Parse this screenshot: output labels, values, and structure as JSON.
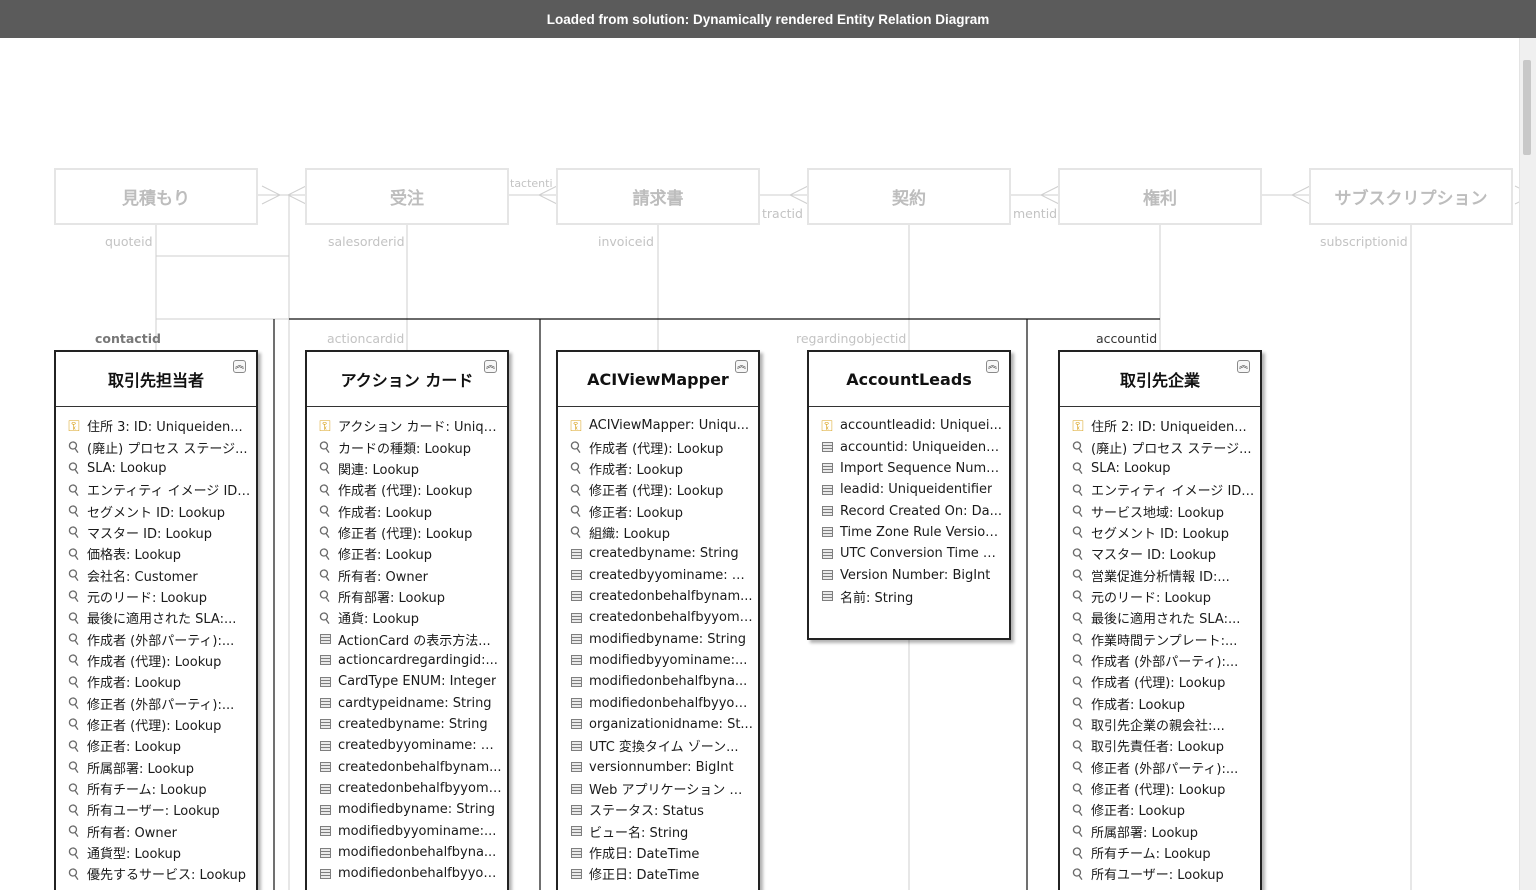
{
  "window": {
    "title": "Loaded from solution: Dynamically rendered Entity Relation Diagram"
  },
  "top_entities": [
    "見積もり",
    "受注",
    "請求書",
    "契約",
    "権利",
    "サブスクリプション"
  ],
  "relation_labels": {
    "quoteid": "quoteid",
    "salesorderid": "salesorderid",
    "invoiceid": "invoiceid",
    "subscriptionid": "subscriptionid",
    "contactid": "contactid",
    "actioncardid": "actioncardid",
    "regardingobjectid": "regardingobjectid",
    "accountid": "accountid",
    "overlap_contractid": "tractid",
    "overlap_entitlementid": "mentid",
    "overlap_salesorder": "tactenti"
  },
  "entities": [
    {
      "title": "取引先担当者",
      "rows": [
        {
          "icon": "primary-key",
          "text": "住所 3: ID: Uniqueiden..."
        },
        {
          "icon": "foreign-key",
          "text": "(廃止) プロセス ステージ..."
        },
        {
          "icon": "foreign-key",
          "text": "SLA: Lookup"
        },
        {
          "icon": "foreign-key",
          "text": "エンティティ イメージ ID:..."
        },
        {
          "icon": "foreign-key",
          "text": "セグメント ID: Lookup"
        },
        {
          "icon": "foreign-key",
          "text": "マスター ID: Lookup"
        },
        {
          "icon": "foreign-key",
          "text": "価格表: Lookup"
        },
        {
          "icon": "foreign-key",
          "text": "会社名: Customer"
        },
        {
          "icon": "foreign-key",
          "text": "元のリード: Lookup"
        },
        {
          "icon": "foreign-key",
          "text": "最後に適用された SLA:..."
        },
        {
          "icon": "foreign-key",
          "text": "作成者 (外部パーティ):..."
        },
        {
          "icon": "foreign-key",
          "text": "作成者 (代理): Lookup"
        },
        {
          "icon": "foreign-key",
          "text": "作成者: Lookup"
        },
        {
          "icon": "foreign-key",
          "text": "修正者 (外部パーティ):..."
        },
        {
          "icon": "foreign-key",
          "text": "修正者 (代理): Lookup"
        },
        {
          "icon": "foreign-key",
          "text": "修正者: Lookup"
        },
        {
          "icon": "foreign-key",
          "text": "所属部署: Lookup"
        },
        {
          "icon": "foreign-key",
          "text": "所有チーム: Lookup"
        },
        {
          "icon": "foreign-key",
          "text": "所有ユーザー: Lookup"
        },
        {
          "icon": "foreign-key",
          "text": "所有者: Owner"
        },
        {
          "icon": "foreign-key",
          "text": "通貨型: Lookup"
        },
        {
          "icon": "foreign-key",
          "text": "優先するサービス: Lookup"
        }
      ]
    },
    {
      "title": "アクション カード",
      "rows": [
        {
          "icon": "primary-key",
          "text": "アクション カード: Unique..."
        },
        {
          "icon": "foreign-key",
          "text": "カードの種類: Lookup"
        },
        {
          "icon": "foreign-key",
          "text": "関連: Lookup"
        },
        {
          "icon": "foreign-key",
          "text": "作成者 (代理): Lookup"
        },
        {
          "icon": "foreign-key",
          "text": "作成者: Lookup"
        },
        {
          "icon": "foreign-key",
          "text": "修正者 (代理): Lookup"
        },
        {
          "icon": "foreign-key",
          "text": "修正者: Lookup"
        },
        {
          "icon": "foreign-key",
          "text": "所有者: Owner"
        },
        {
          "icon": "foreign-key",
          "text": "所有部署: Lookup"
        },
        {
          "icon": "foreign-key",
          "text": "通貨: Lookup"
        },
        {
          "icon": "field",
          "text": "ActionCard の表示方法..."
        },
        {
          "icon": "field",
          "text": "actioncardregardingid:..."
        },
        {
          "icon": "field",
          "text": "CardType ENUM: Integer"
        },
        {
          "icon": "field",
          "text": "cardtypeidname: String"
        },
        {
          "icon": "field",
          "text": "createdbyname: String"
        },
        {
          "icon": "field",
          "text": "createdbyyominame: St..."
        },
        {
          "icon": "field",
          "text": "createdonbehalfbynam..."
        },
        {
          "icon": "field",
          "text": "createdonbehalfbyyomi..."
        },
        {
          "icon": "field",
          "text": "modifiedbyname: String"
        },
        {
          "icon": "field",
          "text": "modifiedbyyominame:..."
        },
        {
          "icon": "field",
          "text": "modifiedonbehalfbyna..."
        },
        {
          "icon": "field",
          "text": "modifiedonbehalfbyyom..."
        }
      ]
    },
    {
      "title": "ACIViewMapper",
      "rows": [
        {
          "icon": "primary-key",
          "text": "ACIViewMapper: Uniqu..."
        },
        {
          "icon": "foreign-key",
          "text": "作成者 (代理): Lookup"
        },
        {
          "icon": "foreign-key",
          "text": "作成者: Lookup"
        },
        {
          "icon": "foreign-key",
          "text": "修正者 (代理): Lookup"
        },
        {
          "icon": "foreign-key",
          "text": "修正者: Lookup"
        },
        {
          "icon": "foreign-key",
          "text": "組織: Lookup"
        },
        {
          "icon": "field",
          "text": "createdbyname: String"
        },
        {
          "icon": "field",
          "text": "createdbyyominame: St..."
        },
        {
          "icon": "field",
          "text": "createdonbehalfbynam..."
        },
        {
          "icon": "field",
          "text": "createdonbehalfbyyomi..."
        },
        {
          "icon": "field",
          "text": "modifiedbyname: String"
        },
        {
          "icon": "field",
          "text": "modifiedbyyominame:..."
        },
        {
          "icon": "field",
          "text": "modifiedonbehalfbyna..."
        },
        {
          "icon": "field",
          "text": "modifiedonbehalfbyyom..."
        },
        {
          "icon": "field",
          "text": "organizationidname: St..."
        },
        {
          "icon": "field",
          "text": "UTC 変換タイム ゾーン..."
        },
        {
          "icon": "field",
          "text": "versionnumber: BigInt"
        },
        {
          "icon": "field",
          "text": "Web アプリケーション エ..."
        },
        {
          "icon": "field",
          "text": "ステータス: Status"
        },
        {
          "icon": "field",
          "text": "ビュー名: String"
        },
        {
          "icon": "field",
          "text": "作成日: DateTime"
        },
        {
          "icon": "field",
          "text": "修正日: DateTime"
        }
      ]
    },
    {
      "title": "AccountLeads",
      "rows": [
        {
          "icon": "primary-key",
          "text": "accountleadid: Uniquei..."
        },
        {
          "icon": "field",
          "text": "accountid: Uniqueidenti..."
        },
        {
          "icon": "field",
          "text": "Import Sequence Numb..."
        },
        {
          "icon": "field",
          "text": "leadid: Uniqueidentifier"
        },
        {
          "icon": "field",
          "text": "Record Created On: Da..."
        },
        {
          "icon": "field",
          "text": "Time Zone Rule Version..."
        },
        {
          "icon": "field",
          "text": "UTC Conversion Time Z..."
        },
        {
          "icon": "field",
          "text": "Version Number: BigInt"
        },
        {
          "icon": "field",
          "text": "名前: String"
        }
      ]
    },
    {
      "title": "取引先企業",
      "rows": [
        {
          "icon": "primary-key",
          "text": "住所 2: ID: Uniqueiden..."
        },
        {
          "icon": "foreign-key",
          "text": "(廃止) プロセス ステージ..."
        },
        {
          "icon": "foreign-key",
          "text": "SLA: Lookup"
        },
        {
          "icon": "foreign-key",
          "text": "エンティティ イメージ ID:..."
        },
        {
          "icon": "foreign-key",
          "text": "サービス地域: Lookup"
        },
        {
          "icon": "foreign-key",
          "text": "セグメント ID: Lookup"
        },
        {
          "icon": "foreign-key",
          "text": "マスター ID: Lookup"
        },
        {
          "icon": "foreign-key",
          "text": "営業促進分析情報 ID:..."
        },
        {
          "icon": "foreign-key",
          "text": "元のリード: Lookup"
        },
        {
          "icon": "foreign-key",
          "text": "最後に適用された SLA:..."
        },
        {
          "icon": "foreign-key",
          "text": "作業時間テンプレート:..."
        },
        {
          "icon": "foreign-key",
          "text": "作成者 (外部パーティ):..."
        },
        {
          "icon": "foreign-key",
          "text": "作成者 (代理): Lookup"
        },
        {
          "icon": "foreign-key",
          "text": "作成者: Lookup"
        },
        {
          "icon": "foreign-key",
          "text": "取引先企業の親会社:..."
        },
        {
          "icon": "foreign-key",
          "text": "取引先責任者: Lookup"
        },
        {
          "icon": "foreign-key",
          "text": "修正者 (外部パーティ):..."
        },
        {
          "icon": "foreign-key",
          "text": "修正者 (代理): Lookup"
        },
        {
          "icon": "foreign-key",
          "text": "修正者: Lookup"
        },
        {
          "icon": "foreign-key",
          "text": "所属部署: Lookup"
        },
        {
          "icon": "foreign-key",
          "text": "所有チーム: Lookup"
        },
        {
          "icon": "foreign-key",
          "text": "所有ユーザー: Lookup"
        }
      ]
    }
  ],
  "icons": {
    "primary-key": "key-gold",
    "foreign-key": "key-gray",
    "field": "field-list",
    "collapse": "double-chevron-up"
  },
  "colors": {
    "titlebar": "#5b5b5b",
    "ghost_border": "#e5e5e5",
    "entity_border": "#222222",
    "pk_key": "#d8a21b"
  }
}
